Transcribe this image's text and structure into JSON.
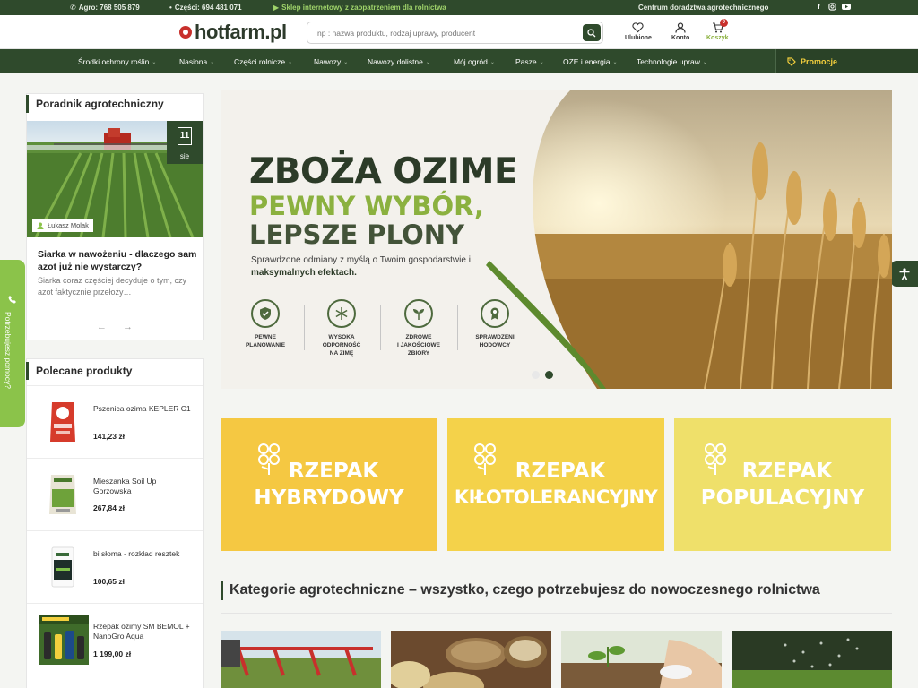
{
  "topbar": {
    "phone_agro": "Agro: 768 505 879",
    "phone_parts": "Części: 694 481 071",
    "tagline": "Sklep internetowy z zaopatrzeniem dla rolnictwa",
    "advisory": "Centrum doradztwa agrotechnicznego",
    "social_icons": [
      "facebook-icon",
      "instagram-icon",
      "youtube-icon"
    ]
  },
  "header": {
    "logo_text": "hotfarm.pl",
    "search_placeholder": "np : nazwa produktu, rodzaj uprawy, producent",
    "favorites_label": "Ulubione",
    "account_label": "Konto",
    "cart_label": "Koszyk",
    "cart_count": "0"
  },
  "nav": {
    "items": [
      "Środki ochrony roślin",
      "Nasiona",
      "Części rolnicze",
      "Nawozy",
      "Nawozy dolistne",
      "Mój ogród",
      "Pasze",
      "OZE i energia",
      "Technologie upraw"
    ],
    "promo": "Promocje"
  },
  "guide": {
    "title": "Poradnik agrotechniczny",
    "date_day": "11",
    "date_month": "sie",
    "author": "Łukasz Molak",
    "article_title": "Siarka w nawożeniu - dlaczego sam azot już nie wystarczy?",
    "excerpt": "Siarka coraz częściej decyduje o tym, czy azot faktycznie przełoży…"
  },
  "featured": {
    "title": "Polecane produkty",
    "products": [
      {
        "name": "Pszenica ozima KEPLER C1",
        "price": "141,23 zł"
      },
      {
        "name": "Mieszanka Soil Up Gorzowska",
        "price": "267,84 zł"
      },
      {
        "name": "bi słoma - rozkład resztek",
        "price": "100,65 zł"
      },
      {
        "name": "Rzepak ozimy SM BEMOL + NanoGro Aqua",
        "price": "1 199,00 zł"
      }
    ]
  },
  "help_tab": "Potrzebujesz pomocy?",
  "hero": {
    "headline": "ZBOŻA OZIME",
    "line2": "PEWNY WYBÓR,",
    "line3": "LEPSZE PLONY",
    "sub_prefix": "Sprawdzone odmiany z myślą o Twoim gospodarstwie i ",
    "sub_bold": "maksymalnych efektach.",
    "features": [
      {
        "l1": "PEWNE",
        "l2": "PLANOWANIE",
        "l3": ""
      },
      {
        "l1": "WYSOKA",
        "l2": "ODPORNOŚĆ",
        "l3": "NA ZIMĘ"
      },
      {
        "l1": "ZDROWE",
        "l2": "I JAKOŚCIOWE",
        "l3": "ZBIORY"
      },
      {
        "l1": "SPRAWDZENI",
        "l2": "HODOWCY",
        "l3": ""
      }
    ]
  },
  "rapeseed": [
    {
      "l1": "RZEPAK",
      "l2": "HYBRYDOWY",
      "color": "#f5c842"
    },
    {
      "l1": "RZEPAK",
      "l2": "KIŁOTOLERANCYJNY",
      "color": "#f4d24a"
    },
    {
      "l1": "RZEPAK",
      "l2": "POPULACYJNY",
      "color": "#efe06a"
    }
  ],
  "categories": {
    "title": "Kategorie agrotechniczne – wszystko, czego potrzebujesz do nowoczesnego rolnictwa"
  },
  "colors": {
    "primary": "#2f4a2c",
    "accent_green": "#8bc34a",
    "promo_yellow": "#f3cf3d",
    "cart_red": "#c8302c"
  }
}
